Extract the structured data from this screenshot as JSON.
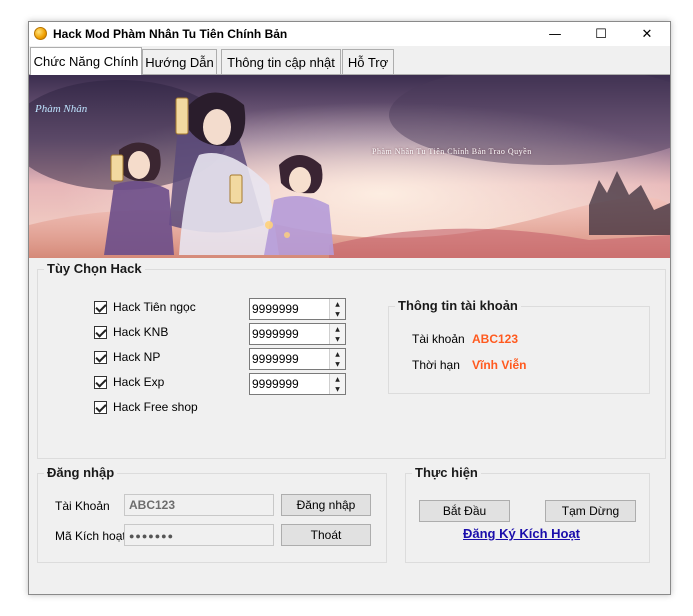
{
  "window": {
    "title": "Hack Mod Phàm Nhân Tu Tiên Chính Bản",
    "minimize_glyph": "—",
    "maximize_glyph": "☐",
    "close_glyph": "✕"
  },
  "tabs": [
    {
      "label": "Chức Năng Chính",
      "active": true
    },
    {
      "label": "Hướng Dẫn",
      "active": false
    },
    {
      "label": "Thông tin cập nhật",
      "active": false
    },
    {
      "label": "Hỗ Trợ",
      "active": false
    }
  ],
  "banner": {
    "subtitle": "Phàm Nhân Tu Tiên Chính Bản Trao Quyền"
  },
  "hack_options": {
    "title": "Tùy Chọn Hack",
    "items": [
      {
        "label": "Hack Tiên ngọc",
        "checked": true,
        "value": "9999999"
      },
      {
        "label": "Hack KNB",
        "checked": true,
        "value": "9999999"
      },
      {
        "label": "Hack NP",
        "checked": true,
        "value": "9999999"
      },
      {
        "label": "Hack Exp",
        "checked": true,
        "value": "9999999"
      },
      {
        "label": "Hack Free shop",
        "checked": true
      }
    ]
  },
  "account_info": {
    "title": "Thông tin tài khoản",
    "account_label": "Tài khoản",
    "account_value": "ABC123",
    "expiry_label": "Thời hạn",
    "expiry_value": "Vĩnh Viễn"
  },
  "login": {
    "title": "Đăng nhập",
    "account_label": "Tài Khoản",
    "account_value": "ABC123",
    "code_label": "Mã Kích hoạt",
    "code_value": "●●●●●●●",
    "login_button": "Đăng nhập",
    "exit_button": "Thoát"
  },
  "execute": {
    "title": "Thực hiện",
    "start_button": "Bắt Đầu",
    "pause_button": "Tạm Dừng",
    "register_link": "Đăng Ký Kích Hoạt"
  },
  "colors": {
    "accent_orange": "#ff5a1f",
    "link_blue": "#1a0dab",
    "window_bg": "#f0f0f0"
  }
}
